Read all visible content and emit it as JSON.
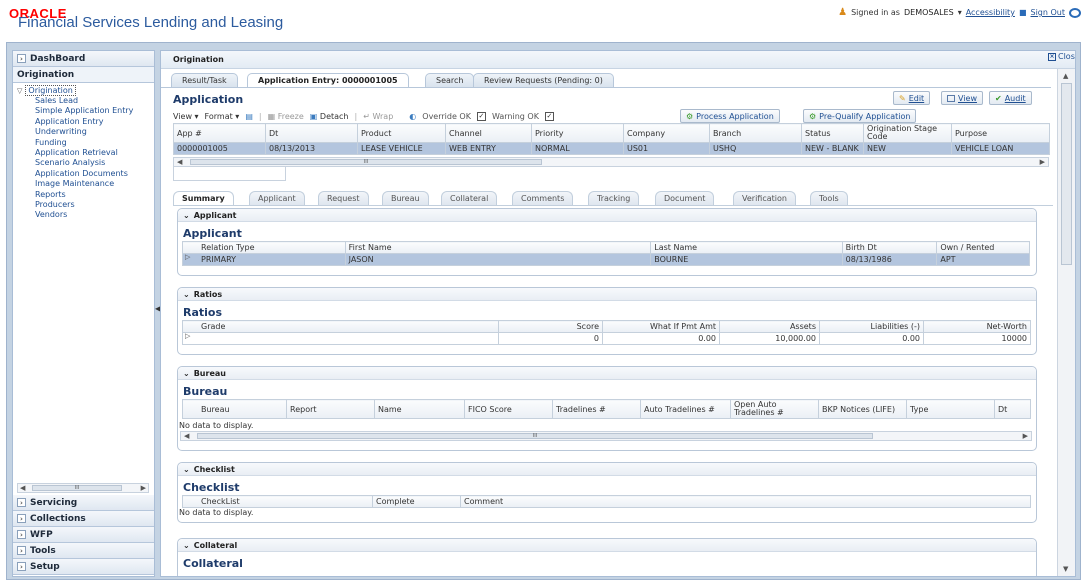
{
  "header": {
    "logo": "ORACLE",
    "app_title": "Financial Services Lending and Leasing",
    "signed_in_label": "Signed in as",
    "user": "DEMOSALES",
    "accessibility": "Accessibility",
    "sign_out": "Sign Out"
  },
  "sidebar": {
    "dashboard": "DashBoard",
    "origination": "Origination",
    "origination_node": "Origination",
    "items": [
      "Sales Lead",
      "Simple Application Entry",
      "Application Entry",
      "Underwriting",
      "Funding",
      "Application Retrieval",
      "Scenario Analysis",
      "Application Documents",
      "Image Maintenance",
      "Reports",
      "Producers",
      "Vendors"
    ],
    "bottom": [
      "Servicing",
      "Collections",
      "WFP",
      "Tools",
      "Setup"
    ],
    "scroll_mid": "III"
  },
  "main": {
    "title": "Origination",
    "close": "Close",
    "tabs": [
      "Result/Task",
      "Application Entry: 0000001005",
      "Search",
      "Review Requests (Pending: 0)"
    ],
    "application_title": "Application",
    "toolbar": {
      "view": "View",
      "format": "Format",
      "freeze": "Freeze",
      "detach": "Detach",
      "wrap": "Wrap",
      "override_ok": "Override OK",
      "warning_ok": "Warning OK",
      "process": "Process Application",
      "prequalify": "Pre-Qualify Application",
      "edit": "Edit",
      "view_btn": "View",
      "audit": "Audit"
    },
    "app_grid": {
      "headers": [
        "App #",
        "Dt",
        "Product",
        "Channel",
        "Priority",
        "Company",
        "Branch",
        "Status",
        "Origination Stage Code",
        "Purpose"
      ],
      "row": [
        "0000001005",
        "08/13/2013",
        "LEASE VEHICLE",
        "WEB ENTRY",
        "NORMAL",
        "US01",
        "USHQ",
        "NEW - BLANK",
        "NEW",
        "VEHICLE LOAN"
      ],
      "scroll_mid": "III"
    },
    "subtabs": [
      "Summary",
      "Applicant",
      "Request",
      "Bureau",
      "Collateral",
      "Comments",
      "Tracking",
      "Document",
      "Verification",
      "Tools"
    ],
    "applicant": {
      "header": "Applicant",
      "title": "Applicant",
      "headers": [
        "Relation Type",
        "First Name",
        "Last Name",
        "Birth Dt",
        "Own / Rented"
      ],
      "row": [
        "PRIMARY",
        "JASON",
        "BOURNE",
        "08/13/1986",
        "APT"
      ]
    },
    "ratios": {
      "header": "Ratios",
      "title": "Ratios",
      "headers": [
        "Grade",
        "Score",
        "What If Pmt Amt",
        "Assets",
        "Liabilities (-)",
        "Net-Worth"
      ],
      "row": [
        "",
        "0",
        "0.00",
        "10,000.00",
        "0.00",
        "10000"
      ]
    },
    "bureau": {
      "header": "Bureau",
      "title": "Bureau",
      "headers": [
        "Bureau",
        "Report",
        "Name",
        "FICO Score",
        "Tradelines #",
        "Auto Tradelines #",
        "Open Auto Tradelines #",
        "BKP Notices (LIFE)",
        "Type",
        "Dt"
      ],
      "nodata": "No data to display.",
      "scroll_mid": "III"
    },
    "checklist": {
      "header": "Checklist",
      "title": "Checklist",
      "headers": [
        "CheckList",
        "Complete",
        "Comment"
      ],
      "nodata": "No data to display."
    },
    "collateral": {
      "header": "Collateral",
      "title": "Collateral"
    }
  },
  "colors": {
    "accent": "#1f4f92",
    "selected_row": "#b3c5de",
    "oracle_red": "#ff0000"
  }
}
